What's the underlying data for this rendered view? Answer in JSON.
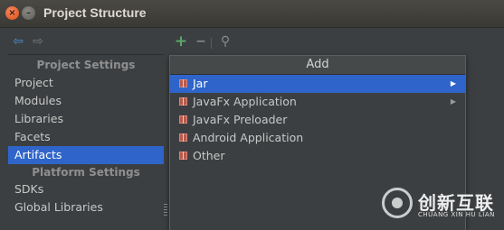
{
  "window": {
    "title": "Project Structure",
    "close_glyph": "×",
    "minimize_glyph": "–"
  },
  "toolbar": {
    "back_glyph": "⇦",
    "forward_glyph": "⇨",
    "add_glyph": "+",
    "remove_glyph": "−",
    "find_glyph": "⚲"
  },
  "sidebar": {
    "project_settings_header": "Project Settings",
    "platform_settings_header": "Platform Settings",
    "project_items": [
      "Project",
      "Modules",
      "Libraries",
      "Facets",
      "Artifacts"
    ],
    "platform_items": [
      "SDKs",
      "Global Libraries"
    ],
    "selected": "Artifacts"
  },
  "popup": {
    "header": "Add",
    "items": [
      {
        "label": "Jar",
        "submenu": true,
        "selected": true
      },
      {
        "label": "JavaFx Application",
        "submenu": true,
        "selected": false
      },
      {
        "label": "JavaFx Preloader",
        "submenu": false,
        "selected": false
      },
      {
        "label": "Android Application",
        "submenu": false,
        "selected": false
      },
      {
        "label": "Other",
        "submenu": false,
        "selected": false
      }
    ],
    "submenu_glyph": "▶"
  },
  "watermark": {
    "text": "创新互联",
    "subtext": "CHUANG XIN HU LIAN"
  },
  "colors": {
    "background": "#3c3f41",
    "selection": "#2f65ca",
    "add_green": "#59a869",
    "back_blue": "#4e8ed6"
  }
}
